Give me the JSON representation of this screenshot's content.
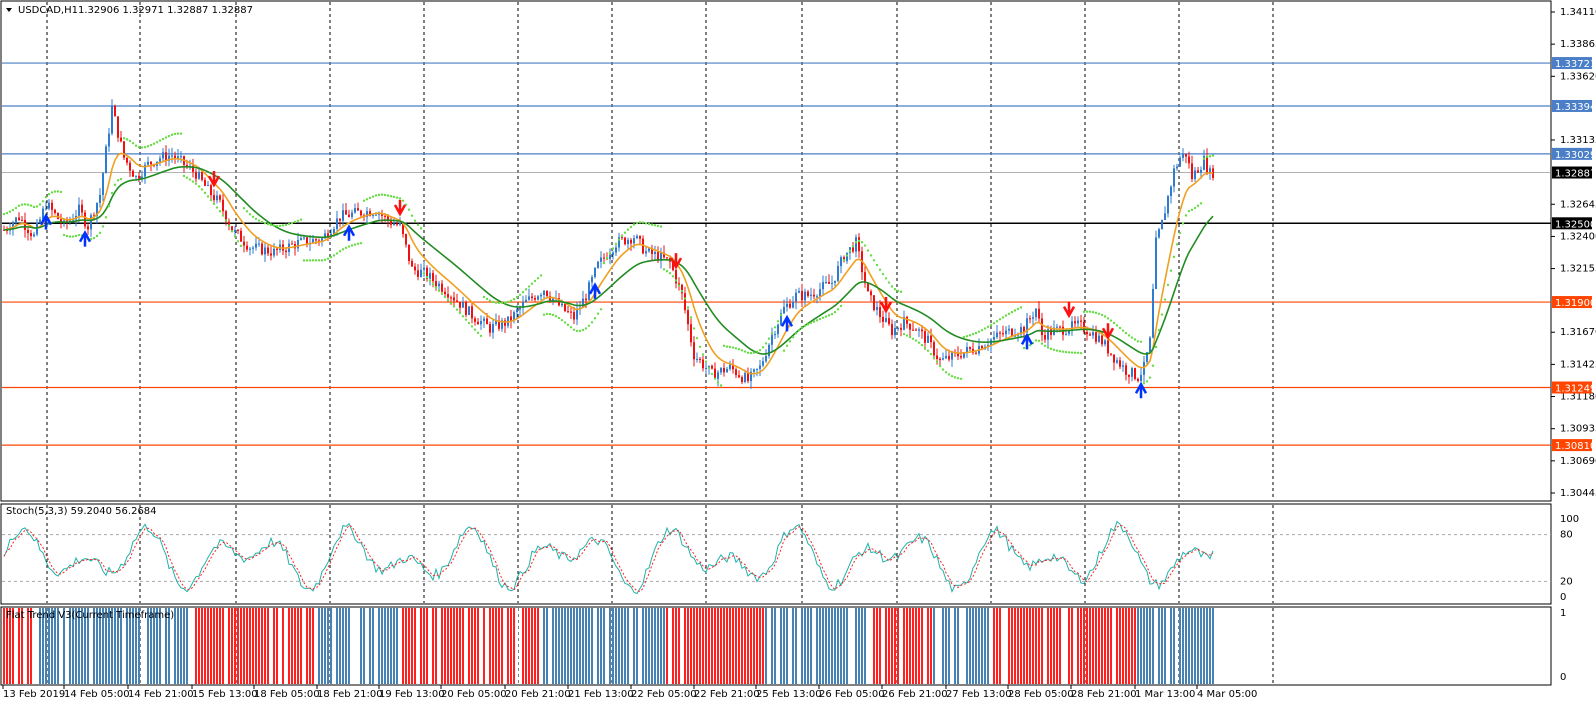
{
  "window": {
    "symbol": "USDCAD,H1",
    "quote": "1.32906 1.32971 1.32887 1.32887"
  },
  "chart_data": [
    {
      "type": "candlestick",
      "title": "USDCAD,H1",
      "ylim": [
        1.30445,
        1.3411
      ],
      "y_ticks": [
        "1.34110",
        "1.33865",
        "1.33620",
        "1.33135",
        "1.32645",
        "1.32400",
        "1.32155",
        "1.31670",
        "1.31425",
        "1.31180",
        "1.30935",
        "1.30690",
        "1.30445"
      ],
      "x_ticks": [
        "13 Feb 2019",
        "14 Feb 05:00",
        "14 Feb 21:00",
        "15 Feb 13:00",
        "18 Feb 05:00",
        "18 Feb 21:00",
        "19 Feb 13:00",
        "20 Feb 05:00",
        "20 Feb 21:00",
        "21 Feb 13:00",
        "22 Feb 05:00",
        "22 Feb 21:00",
        "25 Feb 13:00",
        "26 Feb 05:00",
        "26 Feb 21:00",
        "27 Feb 13:00",
        "28 Feb 05:00",
        "28 Feb 21:00",
        "1 Mar 13:00",
        "4 Mar 05:00"
      ],
      "levels": [
        {
          "value": 1.33721,
          "label": "1.33721",
          "color": "#4a7ec8"
        },
        {
          "value": 1.33394,
          "label": "1.33394",
          "color": "#4a7ec8"
        },
        {
          "value": 1.33029,
          "label": "1.33029",
          "color": "#4a7ec8"
        },
        {
          "value": 1.325,
          "label": "1.32500",
          "color": "#000000"
        },
        {
          "value": 1.319,
          "label": "1.31900",
          "color": "#ff4500"
        },
        {
          "value": 1.31249,
          "label": "1.31249",
          "color": "#ff4500"
        },
        {
          "value": 1.3081,
          "label": "1.30810",
          "color": "#ff4500"
        }
      ],
      "current_price": {
        "value": 1.32887,
        "label": "1.32887"
      },
      "close_path": [
        [
          0,
          1.3245
        ],
        [
          5,
          1.3255
        ],
        [
          10,
          1.324
        ],
        [
          14,
          1.3265
        ],
        [
          20,
          1.3248
        ],
        [
          25,
          1.326
        ],
        [
          28,
          1.3248
        ],
        [
          32,
          1.3272
        ],
        [
          36,
          1.3338
        ],
        [
          40,
          1.33
        ],
        [
          44,
          1.3285
        ],
        [
          48,
          1.3295
        ],
        [
          52,
          1.33
        ],
        [
          56,
          1.3302
        ],
        [
          60,
          1.3295
        ],
        [
          64,
          1.3288
        ],
        [
          68,
          1.3275
        ],
        [
          72,
          1.3265
        ],
        [
          76,
          1.3245
        ],
        [
          82,
          1.3232
        ],
        [
          90,
          1.3228
        ],
        [
          98,
          1.3235
        ],
        [
          106,
          1.3238
        ],
        [
          112,
          1.3255
        ],
        [
          118,
          1.3258
        ],
        [
          124,
          1.326
        ],
        [
          128,
          1.3252
        ],
        [
          132,
          1.3248
        ],
        [
          136,
          1.3215
        ],
        [
          140,
          1.3212
        ],
        [
          148,
          1.3198
        ],
        [
          156,
          1.318
        ],
        [
          162,
          1.317
        ],
        [
          168,
          1.3175
        ],
        [
          174,
          1.319
        ],
        [
          180,
          1.32
        ],
        [
          186,
          1.3185
        ],
        [
          190,
          1.3178
        ],
        [
          194,
          1.3195
        ],
        [
          198,
          1.3218
        ],
        [
          204,
          1.3235
        ],
        [
          210,
          1.324
        ],
        [
          214,
          1.3228
        ],
        [
          218,
          1.3225
        ],
        [
          222,
          1.322
        ],
        [
          226,
          1.3195
        ],
        [
          230,
          1.315
        ],
        [
          236,
          1.3135
        ],
        [
          242,
          1.314
        ],
        [
          248,
          1.313
        ],
        [
          252,
          1.314
        ],
        [
          256,
          1.3165
        ],
        [
          260,
          1.3185
        ],
        [
          264,
          1.3195
        ],
        [
          268,
          1.3195
        ],
        [
          272,
          1.32
        ],
        [
          276,
          1.3205
        ],
        [
          280,
          1.3225
        ],
        [
          284,
          1.3235
        ],
        [
          288,
          1.3195
        ],
        [
          292,
          1.318
        ],
        [
          296,
          1.3168
        ],
        [
          300,
          1.3175
        ],
        [
          304,
          1.317
        ],
        [
          308,
          1.316
        ],
        [
          312,
          1.3145
        ],
        [
          316,
          1.3148
        ],
        [
          320,
          1.3152
        ],
        [
          324,
          1.3155
        ],
        [
          328,
          1.316
        ],
        [
          332,
          1.3165
        ],
        [
          336,
          1.3168
        ],
        [
          340,
          1.317
        ],
        [
          344,
          1.3185
        ],
        [
          346,
          1.3165
        ],
        [
          350,
          1.3168
        ],
        [
          354,
          1.317
        ],
        [
          358,
          1.3172
        ],
        [
          362,
          1.3168
        ],
        [
          366,
          1.316
        ],
        [
          370,
          1.3148
        ],
        [
          374,
          1.3138
        ],
        [
          378,
          1.3133
        ],
        [
          380,
          1.314
        ],
        [
          382,
          1.316
        ],
        [
          384,
          1.3235
        ],
        [
          386,
          1.325
        ],
        [
          388,
          1.327
        ],
        [
          390,
          1.329
        ],
        [
          392,
          1.33
        ],
        [
          394,
          1.3303
        ],
        [
          396,
          1.3285
        ],
        [
          398,
          1.3292
        ],
        [
          400,
          1.3298
        ],
        [
          402,
          1.3288
        ],
        [
          403,
          1.3289
        ]
      ],
      "indicators": [
        {
          "name": "EMA",
          "color": "#f0a020"
        },
        {
          "name": "SMA",
          "color": "#228b22"
        },
        {
          "name": "Parabolic SAR",
          "color": "#66dd44"
        }
      ]
    },
    {
      "type": "line",
      "title": "Stoch(5,3,3) 59.2040 56.2684",
      "ylim": [
        0,
        100
      ],
      "y_ticks": [
        "100",
        "80",
        "20",
        "0"
      ],
      "levels": [
        80,
        20
      ],
      "series": [
        {
          "name": "main",
          "color": "#20b2aa"
        },
        {
          "name": "signal",
          "color": "#ff2020"
        }
      ],
      "last_values": [
        59.204,
        56.2684
      ]
    },
    {
      "type": "bar",
      "title": "Flat Trend V3(Current Timeframe)",
      "ylim": [
        0,
        1
      ],
      "y_ticks": [
        "1",
        "0"
      ],
      "colors": {
        "up": "#4682b4",
        "down": "#ff2020",
        "flat": "#ffffff"
      },
      "segments": [
        {
          "state": "down",
          "from": 0,
          "to": 10
        },
        {
          "state": "up",
          "from": 10,
          "to": 64
        },
        {
          "state": "down",
          "from": 64,
          "to": 105
        },
        {
          "state": "up",
          "from": 105,
          "to": 133
        },
        {
          "state": "down",
          "from": 133,
          "to": 180
        },
        {
          "state": "up",
          "from": 180,
          "to": 221
        },
        {
          "state": "down",
          "from": 221,
          "to": 254
        },
        {
          "state": "up",
          "from": 254,
          "to": 290
        },
        {
          "state": "down",
          "from": 290,
          "to": 310
        },
        {
          "state": "up",
          "from": 310,
          "to": 330
        },
        {
          "state": "down",
          "from": 330,
          "to": 378
        },
        {
          "state": "up",
          "from": 378,
          "to": 404
        }
      ]
    }
  ]
}
